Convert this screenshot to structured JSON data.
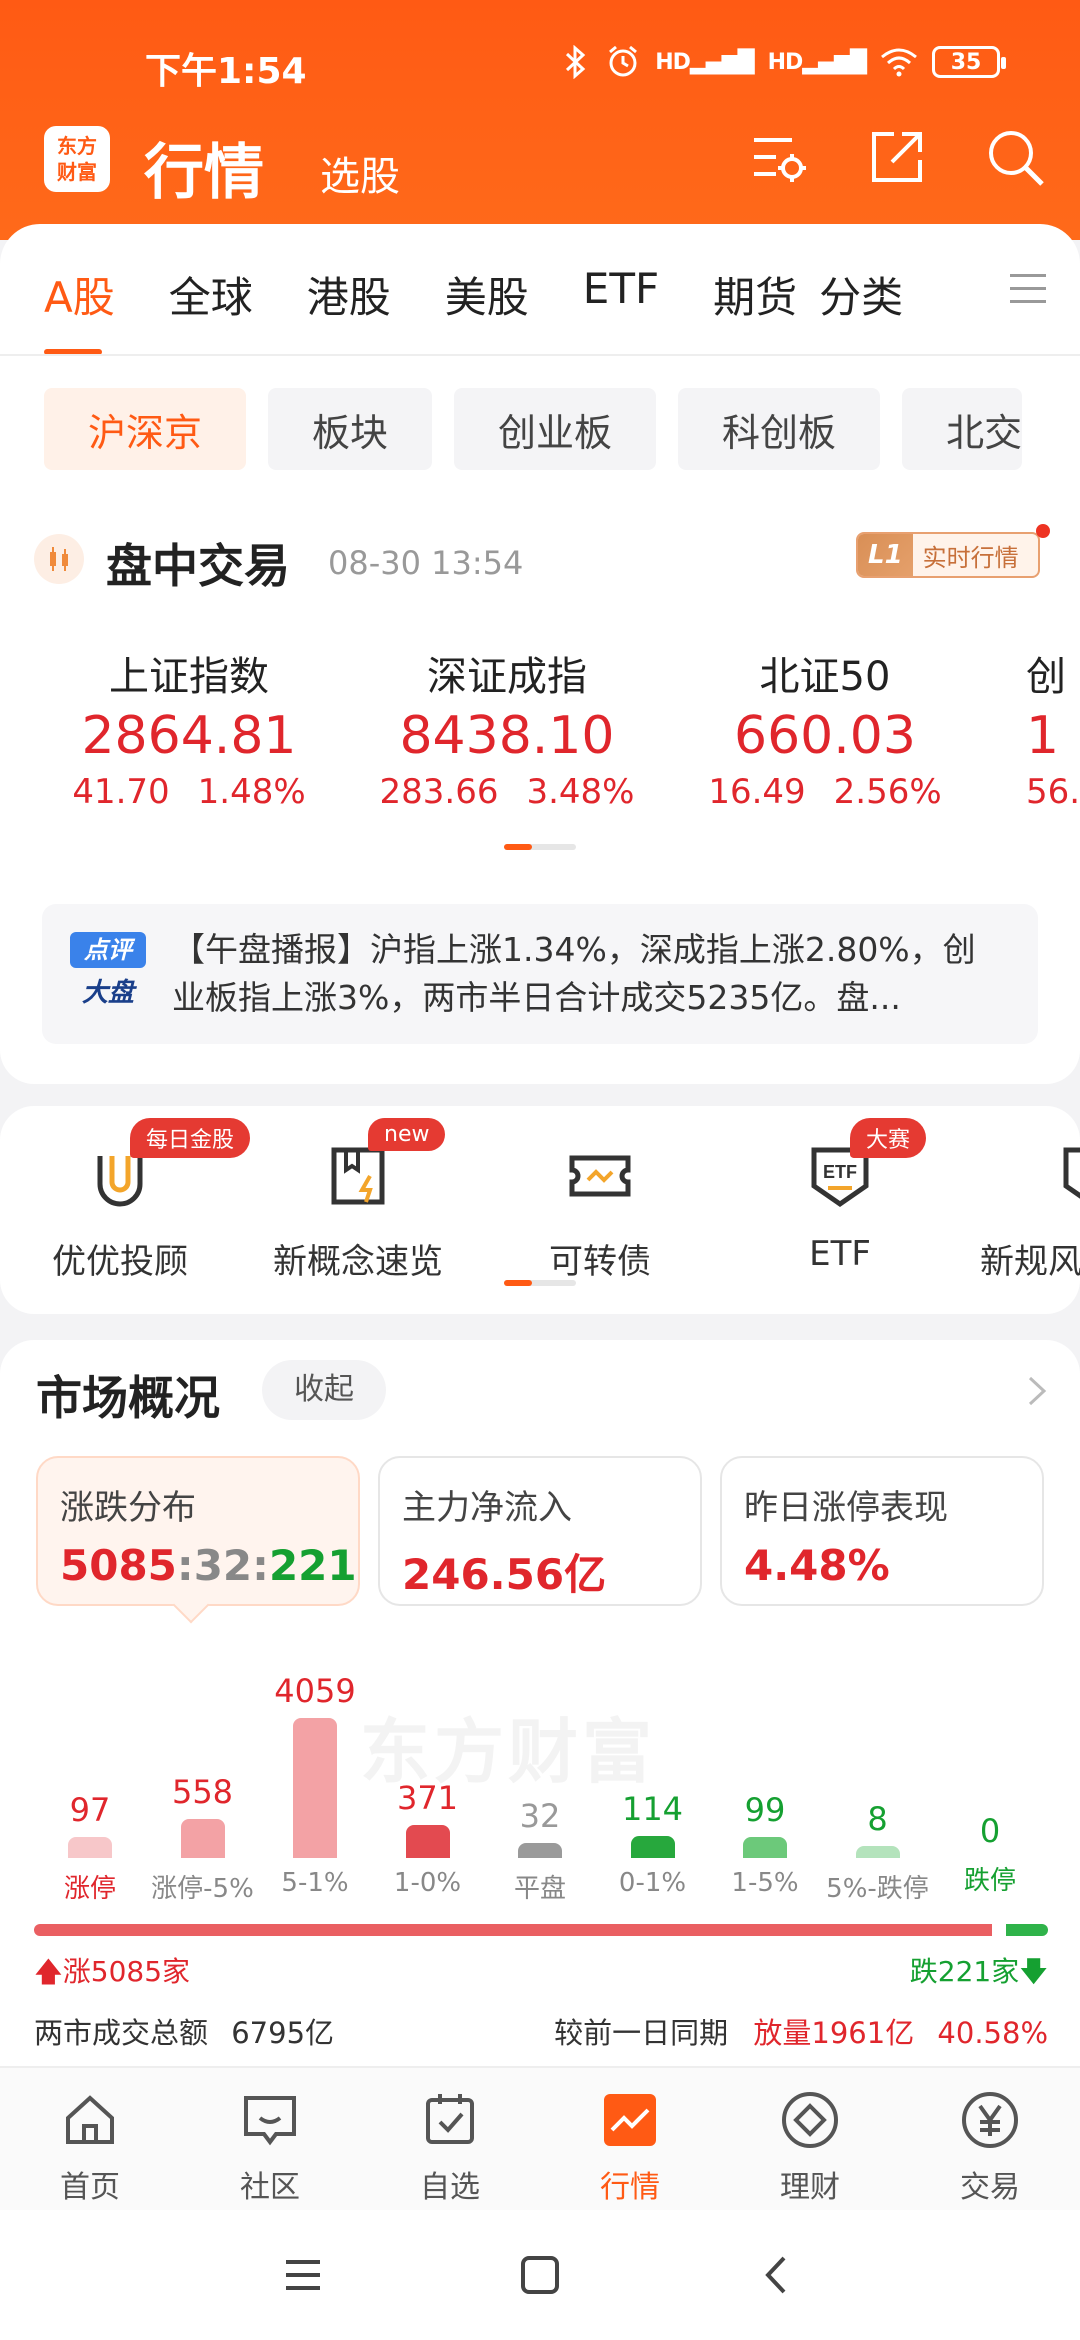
{
  "status": {
    "time": "下午1:54",
    "battery": "35",
    "hd1": "HD",
    "hd2": "HD"
  },
  "appbar": {
    "logo_line1": "东方",
    "logo_line2": "财富",
    "title": "行情",
    "subtitle": "选股"
  },
  "tabs": [
    "A股",
    "全球",
    "港股",
    "美股",
    "ETF",
    "期货",
    "分类"
  ],
  "chips": [
    "沪深京",
    "板块",
    "创业板",
    "科创板",
    "北交所"
  ],
  "live": {
    "title": "盘中交易",
    "time": "08-30 13:54",
    "badge_l1": "L1",
    "badge_text": "实时行情"
  },
  "indices": [
    {
      "name": "上证指数",
      "value": "2864.81",
      "change": "41.70",
      "pct": "1.48%"
    },
    {
      "name": "深证成指",
      "value": "8438.10",
      "change": "283.66",
      "pct": "3.48%"
    },
    {
      "name": "北证50",
      "value": "660.03",
      "change": "16.49",
      "pct": "2.56%"
    },
    {
      "name": "创",
      "value": "1",
      "change": "56.",
      "pct": ""
    }
  ],
  "news": {
    "tag1": "点评",
    "tag2": "大盘",
    "text": "【午盘播报】沪指上涨1.34%，深成指上涨2.80%，创业板指上涨3%，两市半日合计成交5235亿。盘..."
  },
  "shortcuts": [
    {
      "label": "优优投顾",
      "badge": "每日金股"
    },
    {
      "label": "新概念速览",
      "badge": "new"
    },
    {
      "label": "可转债",
      "badge": ""
    },
    {
      "label": "ETF",
      "badge": "大赛"
    },
    {
      "label": "新规风",
      "badge": ""
    }
  ],
  "overview": {
    "title": "市场概况",
    "collapse": "收起",
    "cards": [
      {
        "label": "涨跌分布",
        "up": "5085",
        "sep1": ":",
        "flat": "32",
        "sep2": ":",
        "down": "221"
      },
      {
        "label": "主力净流入",
        "value": "246.56亿"
      },
      {
        "label": "昨日涨停表现",
        "value": "4.48%"
      }
    ],
    "watermark": "东方财富",
    "distribution": [
      {
        "cat": "涨停",
        "count": "97",
        "value": 97,
        "kind": "up-limit"
      },
      {
        "cat": "涨停-5%",
        "count": "558",
        "value": 558,
        "kind": "up"
      },
      {
        "cat": "5-1%",
        "count": "4059",
        "value": 4059,
        "kind": "up"
      },
      {
        "cat": "1-0%",
        "count": "371",
        "value": 371,
        "kind": "up-strong"
      },
      {
        "cat": "平盘",
        "count": "32",
        "value": 32,
        "kind": "flat"
      },
      {
        "cat": "0-1%",
        "count": "114",
        "value": 114,
        "kind": "down-strong"
      },
      {
        "cat": "1-5%",
        "count": "99",
        "value": 99,
        "kind": "down"
      },
      {
        "cat": "5%-跌停",
        "count": "8",
        "value": 8,
        "kind": "down-light"
      },
      {
        "cat": "跌停",
        "count": "0",
        "value": 0,
        "kind": "down-limit"
      }
    ],
    "up_label": "涨5085家",
    "down_label": "跌221家",
    "up_count": 5085,
    "down_count": 221,
    "turnover_label": "两市成交总额",
    "turnover_value": "6795亿",
    "compare_label": "较前一日同期",
    "compare_value": "放量1961亿",
    "compare_pct": "40.58%"
  },
  "bottomnav": [
    "首页",
    "社区",
    "自选",
    "行情",
    "理财",
    "交易"
  ],
  "colors": {
    "accent": "#ff5a14",
    "up": "#e0262c",
    "down": "#15a031"
  }
}
